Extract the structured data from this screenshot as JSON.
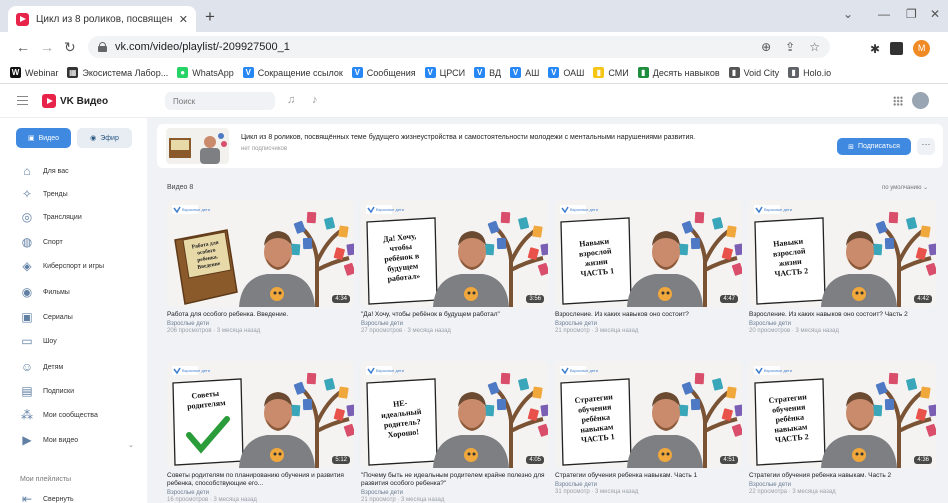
{
  "browser": {
    "tab_title": "Цикл из 8 роликов, посвящен",
    "tab_close": "✕",
    "new_tab": "+",
    "url": "vk.com/video/playlist/-209927500_1",
    "profile_letter": "M",
    "bookmarks": [
      {
        "label": "Webinar",
        "icon": "W",
        "color": "#111111"
      },
      {
        "label": "Экосистема Лабор...",
        "icon": "▦",
        "color": "#333333"
      },
      {
        "label": "WhatsApp",
        "icon": "●",
        "color": "#25d366"
      },
      {
        "label": "Сокращение ссылок",
        "icon": "V",
        "color": "#2787f5"
      },
      {
        "label": "Сообщения",
        "icon": "V",
        "color": "#2787f5"
      },
      {
        "label": "ЦРСИ",
        "icon": "V",
        "color": "#2787f5"
      },
      {
        "label": "ВД",
        "icon": "V",
        "color": "#2787f5"
      },
      {
        "label": "АШ",
        "icon": "V",
        "color": "#2787f5"
      },
      {
        "label": "ОАШ",
        "icon": "V",
        "color": "#2787f5"
      },
      {
        "label": "СМИ",
        "icon": "▮",
        "color": "#f5c518"
      },
      {
        "label": "Десять навыков",
        "icon": "▮",
        "color": "#1e8e3e"
      },
      {
        "label": "Void City",
        "icon": "▮",
        "color": "#555555"
      },
      {
        "label": "Holo.io",
        "icon": "▮",
        "color": "#5f6368"
      }
    ]
  },
  "vk": {
    "logo_text": "VK Видео",
    "search_placeholder": "Поиск"
  },
  "sidebar": {
    "video_button": "Видео",
    "efir_button": "Эфир",
    "items": [
      {
        "label": "Для вас",
        "icon": "⌂"
      },
      {
        "label": "Тренды",
        "icon": "✧"
      },
      {
        "label": "Трансляции",
        "icon": "◎"
      },
      {
        "label": "Спорт",
        "icon": "◍"
      },
      {
        "label": "Киберспорт и игры",
        "icon": "◈"
      },
      {
        "label": "Фильмы",
        "icon": "◉"
      },
      {
        "label": "Сериалы",
        "icon": "▣"
      },
      {
        "label": "Шоу",
        "icon": "▭"
      },
      {
        "label": "Детям",
        "icon": "☺"
      },
      {
        "label": "Подписки",
        "icon": "▤"
      },
      {
        "label": "Мои сообщества",
        "icon": "⁂"
      },
      {
        "label": "Мои видео",
        "icon": "▶"
      }
    ],
    "section_title": "Мои плейлисты",
    "last_item": "Свернуть"
  },
  "playlist": {
    "description": "Цикл из 8 роликов, посвящённых теме будущего жизнеустройства и самостоятельности молодежи с ментальными нарушениями развития.",
    "subscribers": "нет подписчиков",
    "subscribe_label": "Подписаться",
    "more_label": "···",
    "videos_title": "Видео 8",
    "sort_label": "по умолчанию ⌄"
  },
  "videos": [
    {
      "title": "Работа для особого ребенка. Введение.",
      "author": "Взрослые дети",
      "meta": "206 просмотров · 3 месяца назад",
      "duration": "4:34",
      "board_lines": [
        "Работа для",
        "особого",
        "ребенка.",
        "Введение"
      ],
      "board": "book"
    },
    {
      "title": "\"Да! Хочу, чтобы ребёнок в будущем работал\"",
      "author": "Взрослые дети",
      "meta": "27 просмотров · 3 месяца назад",
      "duration": "3:56",
      "board_lines": [
        "Да! Хочу,",
        "чтобы",
        "ребёнок в",
        "будущем",
        "работал»"
      ],
      "board": "page"
    },
    {
      "title": "Взросление. Из каких навыков оно состоит?",
      "author": "Взрослые дети",
      "meta": "21 просмотр · 3 месяца назад",
      "duration": "4:47",
      "board_lines": [
        "Навыки",
        "взрослой",
        "жизни",
        "ЧАСТЬ 1"
      ],
      "board": "page"
    },
    {
      "title": "Взросление. Из каких навыков оно состоит? Часть 2",
      "author": "Взрослые дети",
      "meta": "20 просмотров · 3 месяца назад",
      "duration": "4:42",
      "board_lines": [
        "Навыки",
        "взрослой",
        "жизни",
        "ЧАСТЬ 2"
      ],
      "board": "page"
    },
    {
      "title": "Советы родителям по планированию обучения и развития ребенка, способствующие его...",
      "author": "Взрослые дети",
      "meta": "16 просмотров · 3 месяца назад",
      "duration": "5:12",
      "board_lines": [
        "Советы",
        "родителям"
      ],
      "board": "check"
    },
    {
      "title": "\"Почему быть не идеальным родителем крайне полезно для развития особого ребенка?\"",
      "author": "Взрослые дети",
      "meta": "21 просмотр · 3 месяца назад",
      "duration": "4:05",
      "board_lines": [
        "НЕ-",
        "идеальный",
        "родитель?",
        "Хорошо!"
      ],
      "board": "page"
    },
    {
      "title": "Стратегии обучения ребенка навыкам. Часть 1",
      "author": "Взрослые дети",
      "meta": "31 просмотр · 3 месяца назад",
      "duration": "4:51",
      "board_lines": [
        "Стратегии",
        "обучения",
        "ребёнка",
        "навыкам",
        "ЧАСТЬ 1"
      ],
      "board": "page"
    },
    {
      "title": "Стратегии обучения ребенка навыкам. Часть 2",
      "author": "Взрослые дети",
      "meta": "22 просмотра · 3 месяца назад",
      "duration": "4:36",
      "board_lines": [
        "Стратегии",
        "обучения",
        "ребёнка",
        "навыкам",
        "ЧАСТЬ 2"
      ],
      "board": "page"
    }
  ],
  "thumb_badge": "Взрослые дети"
}
